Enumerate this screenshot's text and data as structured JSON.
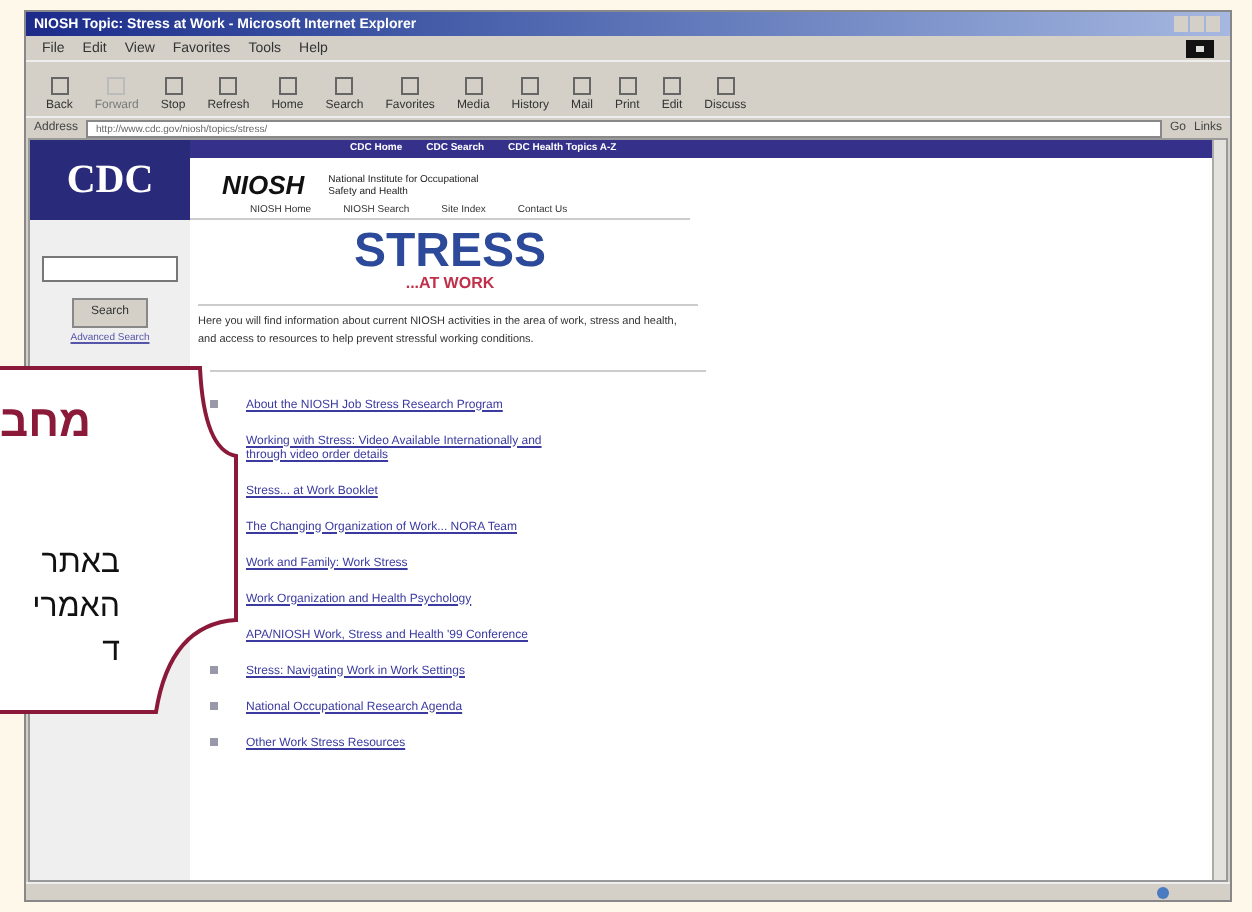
{
  "window": {
    "title": "NIOSH Topic: Stress at Work - Microsoft Internet Explorer"
  },
  "menu": [
    "File",
    "Edit",
    "View",
    "Favorites",
    "Tools",
    "Help"
  ],
  "toolbar": [
    {
      "label": "Back",
      "disabled": false
    },
    {
      "label": "Forward",
      "disabled": true
    },
    {
      "label": "Stop",
      "disabled": false
    },
    {
      "label": "Refresh",
      "disabled": false
    },
    {
      "label": "Home",
      "disabled": false
    },
    {
      "label": "Search",
      "disabled": false
    },
    {
      "label": "Favorites",
      "disabled": false
    },
    {
      "label": "Media",
      "disabled": false
    },
    {
      "label": "History",
      "disabled": false
    },
    {
      "label": "Mail",
      "disabled": false
    },
    {
      "label": "Print",
      "disabled": false
    },
    {
      "label": "Edit",
      "disabled": false
    },
    {
      "label": "Discuss",
      "disabled": false
    }
  ],
  "address_bar": {
    "label": "Address",
    "value": "http://www.cdc.gov/niosh/topics/stress/",
    "go": "Go",
    "links": "Links"
  },
  "page": {
    "cdc_logo": "CDC",
    "top_nav": [
      "CDC Home",
      "CDC Search",
      "CDC Health Topics A-Z"
    ],
    "search_button": "Search",
    "advanced_search": "Advanced Search",
    "niosh_logo": "NIOSH",
    "niosh_name": "National Institute for Occupational Safety and Health",
    "niosh_nav": [
      "NIOSH Home",
      "NIOSH Search",
      "Site Index",
      "Contact Us"
    ],
    "heading": "STRESS",
    "subheading": "...AT WORK",
    "intro": "Here you will find information about current NIOSH activities in the area of work, stress and health, and access to resources to help prevent stressful working conditions.",
    "links": [
      {
        "text": "About the NIOSH Job Stress Research Program",
        "bullet": true
      },
      {
        "text": "Working with Stress: Video Available Internationally and through video order details",
        "bullet": false
      },
      {
        "text": "Stress... at Work Booklet",
        "bullet": false
      },
      {
        "text": "The Changing Organization of Work... NORA Team",
        "bullet": false
      },
      {
        "text": "Work and Family: Work Stress",
        "bullet": false
      },
      {
        "text": "Work Organization and Health Psychology",
        "bullet": false
      },
      {
        "text": "APA/NIOSH Work, Stress and Health '99 Conference",
        "bullet": false
      },
      {
        "text": "Stress: Navigating Work in Work Settings",
        "bullet": true
      },
      {
        "text": "National Occupational Research Agenda",
        "bullet": true
      },
      {
        "text": "Other Work Stress Resources",
        "bullet": true
      }
    ]
  },
  "callout": {
    "title": "מחב",
    "lines": [
      "באתר",
      "האמרי",
      "ד"
    ]
  }
}
